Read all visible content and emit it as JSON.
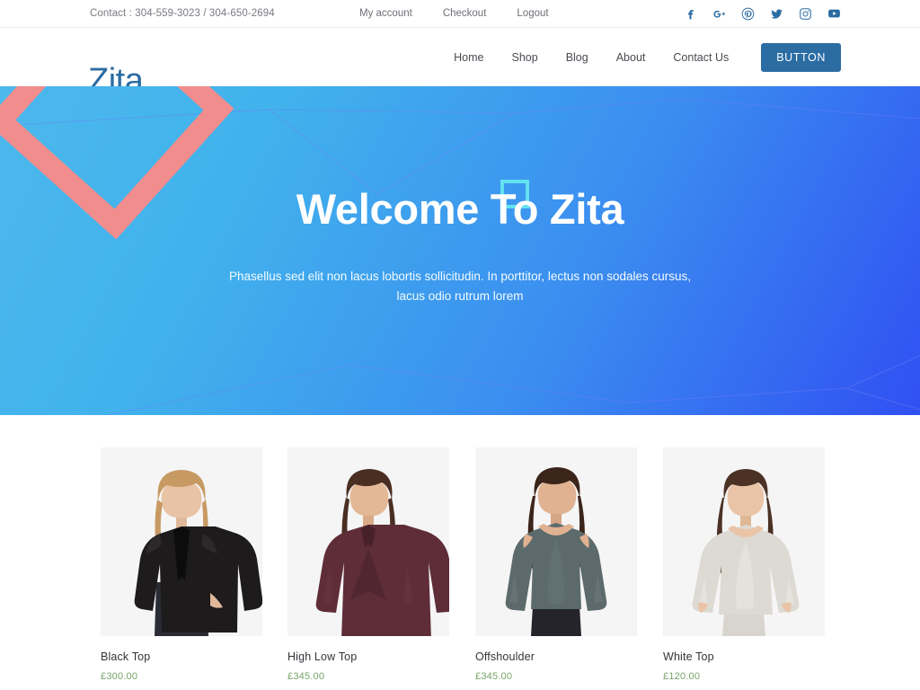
{
  "topbar": {
    "contact": "Contact : 304-559-3023 / 304-650-2694",
    "links": [
      {
        "label": "My account"
      },
      {
        "label": "Checkout"
      },
      {
        "label": "Logout"
      }
    ],
    "social": [
      {
        "name": "facebook-icon"
      },
      {
        "name": "google-plus-icon"
      },
      {
        "name": "pinterest-icon"
      },
      {
        "name": "twitter-icon"
      },
      {
        "name": "instagram-icon"
      },
      {
        "name": "youtube-icon"
      }
    ]
  },
  "header": {
    "logo": "Zita",
    "nav": [
      {
        "label": "Home"
      },
      {
        "label": "Shop"
      },
      {
        "label": "Blog"
      },
      {
        "label": "About"
      },
      {
        "label": "Contact Us"
      }
    ],
    "button_label": "BUTTON"
  },
  "hero": {
    "title": "Welcome To Zita",
    "subtitle": "Phasellus sed elit non lacus lobortis sollicitudin. In porttitor, lectus non sodales cursus, lacus odio rutrum lorem",
    "colors": {
      "gradient_start": "#4cb8ec",
      "gradient_end": "#3050f2",
      "shape_pink": "#f18d8d",
      "shape_cyan": "#63e2f0",
      "dot_cyan": "#4fe9f2"
    },
    "decorations": [
      {
        "name": "rotated-square-outline",
        "color": "#f18d8d"
      },
      {
        "name": "small-square-outline",
        "color": "#63e2f0"
      },
      {
        "name": "triangle",
        "color": "#f18d8d"
      },
      {
        "name": "circle-dot",
        "color": "#4fe9f2"
      }
    ]
  },
  "products": [
    {
      "title": "Black Top",
      "price": "£300.00",
      "garment": "#1d1b1c",
      "hair": "#c79a63",
      "skin": "#e8c3a6",
      "pants": "#2a2c35"
    },
    {
      "title": "High Low Top",
      "price": "£345.00",
      "garment": "#5e2d38",
      "hair": "#4a2e22",
      "skin": "#e3b896",
      "pants": "#1e1c20"
    },
    {
      "title": "Offshoulder",
      "price": "£345.00",
      "garment": "#5c6a6c",
      "hair": "#3b241a",
      "skin": "#e0b291",
      "pants": "#24242a"
    },
    {
      "title": "White Top",
      "price": "£120.00",
      "garment": "#ddd9d3",
      "hair": "#4b3225",
      "skin": "#e9c4a7",
      "pants": "#d8d4ce"
    }
  ],
  "theme": {
    "brand_blue": "#2b6ca3",
    "price_green": "#77a46b",
    "thumb_bg": "#f5f5f5"
  }
}
